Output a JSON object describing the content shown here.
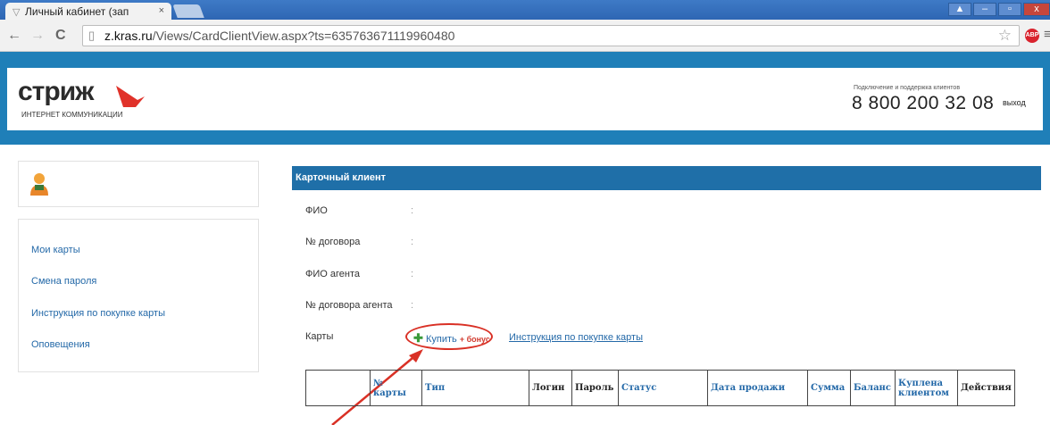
{
  "browser": {
    "tab_title": "Личный кабинет (зап",
    "url_domain": "z.kras.ru",
    "url_path": "/Views/CardClientView.aspx?ts=635763671119960480",
    "abp_label": "ABP"
  },
  "header": {
    "logo_text": "стриж",
    "logo_sub": "ИНТЕРНЕТ КОММУНИКАЦИИ",
    "support_label": "Подключение и поддержка клиентов",
    "phone": "8 800 200 32 08",
    "logout": "выход",
    "brand_color": "#1f7fb8"
  },
  "sidebar": {
    "items": [
      {
        "label": "Мои карты"
      },
      {
        "label": "Смена пароля"
      },
      {
        "label": "Инструкция по покупке карты"
      },
      {
        "label": "Оповещения"
      }
    ]
  },
  "card": {
    "title": "Карточный клиент",
    "fields": [
      {
        "label": "ФИО",
        "value": ""
      },
      {
        "label": "№ договора",
        "value": ""
      },
      {
        "label": "ФИО агента",
        "value": ""
      },
      {
        "label": "№ договора агента",
        "value": ""
      },
      {
        "label": "Карты",
        "value": ""
      }
    ],
    "buy_label": "Купить",
    "buy_bonus": "+ бонус",
    "instruction_link": "Инструкция по покупке карты"
  },
  "table": {
    "columns": [
      "",
      "№ карты",
      "Тип",
      "Логин",
      "Пароль",
      "Статус",
      "Дата продажи",
      "Сумма",
      "Баланс",
      "Куплена клиентом",
      "Действия"
    ]
  }
}
